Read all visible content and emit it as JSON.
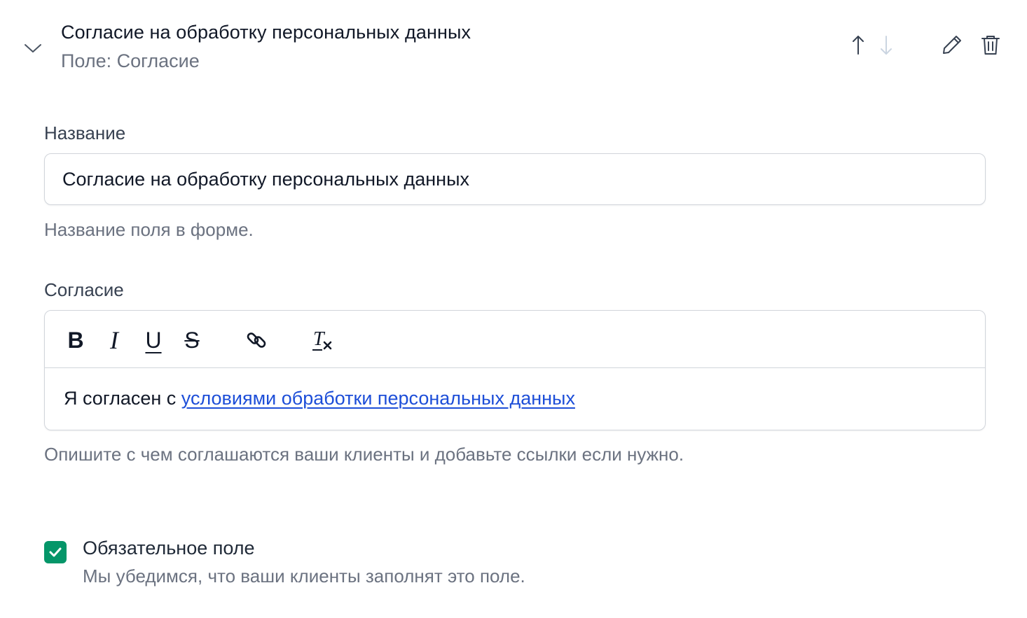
{
  "header": {
    "title": "Согласие на обработку персональных данных",
    "subtitle": "Поле: Согласие",
    "icons": [
      "chevron-down-icon",
      "arrow-up-icon",
      "arrow-down-icon",
      "pencil-icon",
      "trash-icon"
    ]
  },
  "name_field": {
    "label": "Название",
    "value": "Согласие на обработку персональных данных",
    "help": "Название поля в форме."
  },
  "consent_field": {
    "label": "Согласие",
    "toolbar": {
      "bold": "B",
      "italic": "I",
      "underline": "U",
      "strike": "S",
      "icons": [
        "bold-icon",
        "italic-icon",
        "underline-icon",
        "strikethrough-icon",
        "link-icon",
        "clear-format-icon"
      ]
    },
    "content_prefix": "Я согласен с ",
    "content_link": "условиями обработки персональных данных",
    "help": "Опишите с чем соглашаются ваши клиенты и добавьте ссылки если нужно."
  },
  "required": {
    "checked": true,
    "label": "Обязательное поле",
    "help": "Мы убедимся, что ваши клиенты заполнят это поле."
  },
  "colors": {
    "checkbox": "#059669",
    "link": "#1d4ed8",
    "muted": "#6b7280",
    "disabled_icon": "#cbd5e1"
  }
}
